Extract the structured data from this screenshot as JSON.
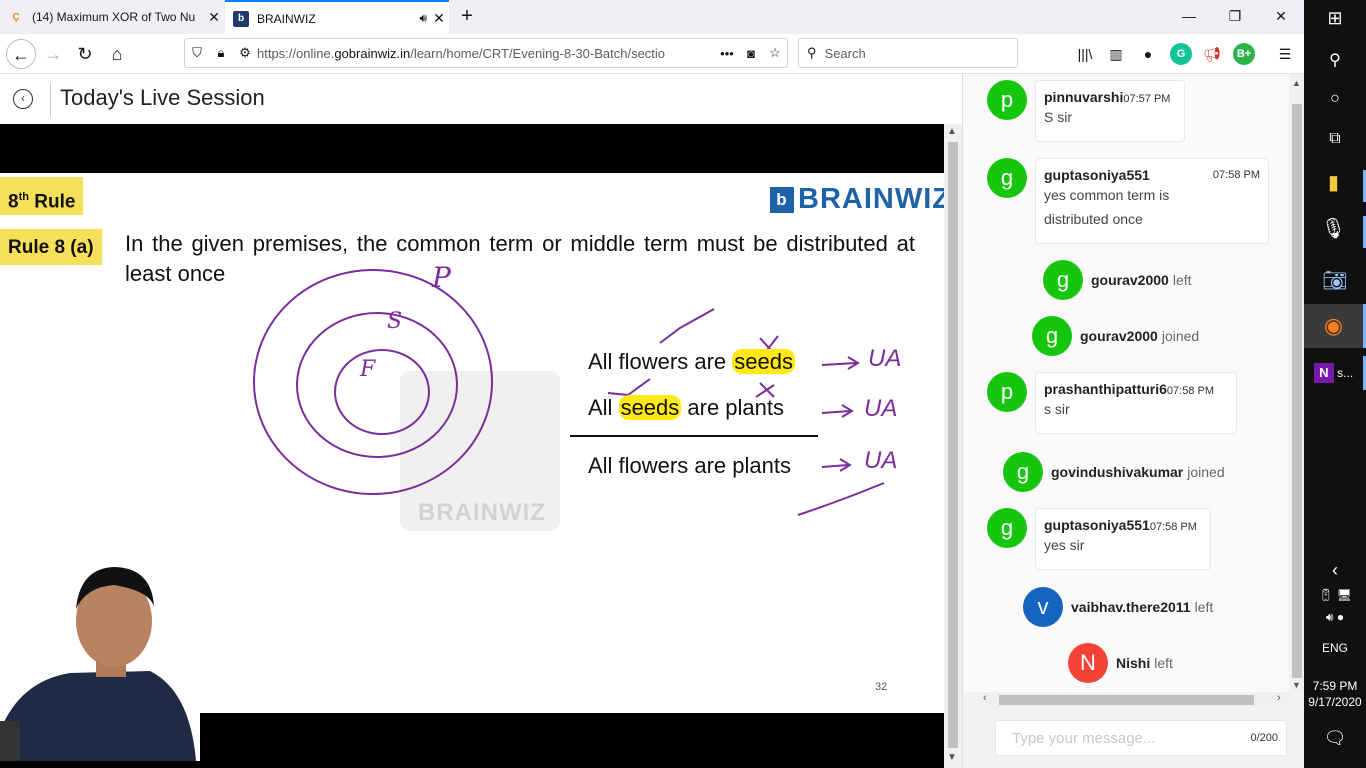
{
  "browser": {
    "tabs": [
      {
        "title": "(14) Maximum XOR of Two Nu",
        "favicon": "leetcode-icon"
      },
      {
        "title": "BRAINWIZ",
        "favicon": "brainwiz-icon",
        "audio": true
      }
    ],
    "url_prefix": "https://online.",
    "url_domain": "gobrainwiz.in",
    "url_path": "/learn/home/CRT/Evening-8-30-Batch/sectio",
    "search_placeholder": "Search",
    "extension_badges": {
      "grammarly": "G",
      "bplus": "B+"
    }
  },
  "page": {
    "title": "Today's Live Session"
  },
  "slide": {
    "rule_label_sup": "th",
    "rule_label_num": "8",
    "rule_label_word": "Rule",
    "subrule_label": "Rule 8 (a)",
    "brand": "BRAINWIZ",
    "brand_mark": "b",
    "rule_text": "In the given premises, the common term or middle term must be distributed at least once",
    "premise1_pre": "All flowers are ",
    "premise1_hl": "seeds",
    "premise2_pre": "All ",
    "premise2_hl": "seeds",
    "premise2_post": " are plants",
    "conclusion": "All flowers are plants",
    "annotation": "UA",
    "circle_labels": [
      "P",
      "S",
      "F"
    ],
    "watermark": "BRAINWIZ",
    "page_number": "32"
  },
  "chat": {
    "items": [
      {
        "type": "message",
        "user": "pinnuvarshi",
        "initial": "p",
        "time": "07:57 PM",
        "text": "S sir"
      },
      {
        "type": "message",
        "user": "guptasoniya551",
        "initial": "g",
        "time": "07:58 PM",
        "text": "yes common term is distributed once"
      },
      {
        "type": "event",
        "user": "gourav2000",
        "initial": "g",
        "action": "left"
      },
      {
        "type": "event",
        "user": "gourav2000",
        "initial": "g",
        "action": "joined"
      },
      {
        "type": "message",
        "user": "prashanthipatturi6",
        "initial": "p",
        "time": "07:58 PM",
        "text": "s sir"
      },
      {
        "type": "event",
        "user": "govindushivakumar",
        "initial": "g",
        "action": "joined"
      },
      {
        "type": "message",
        "user": "guptasoniya551",
        "initial": "g",
        "time": "07:58 PM",
        "text": "yes sir"
      },
      {
        "type": "event",
        "user": "vaibhav.there2011",
        "initial": "v",
        "action": "left",
        "color": "#1565c0"
      },
      {
        "type": "event",
        "user": "Nishi",
        "initial": "N",
        "action": "left",
        "color": "#f44336"
      }
    ],
    "input_placeholder": "Type your message...",
    "char_count": "0/200"
  },
  "taskbar": {
    "onenote_label": "s...",
    "language": "ENG",
    "time": "7:59 PM",
    "date": "9/17/2020"
  },
  "colors": {
    "avatar_green": "#16c60c",
    "slide_yellow": "#f6e05a",
    "highlight": "#ffe814",
    "ink": "#7b2d9b",
    "brand_blue": "#1e63a7"
  }
}
